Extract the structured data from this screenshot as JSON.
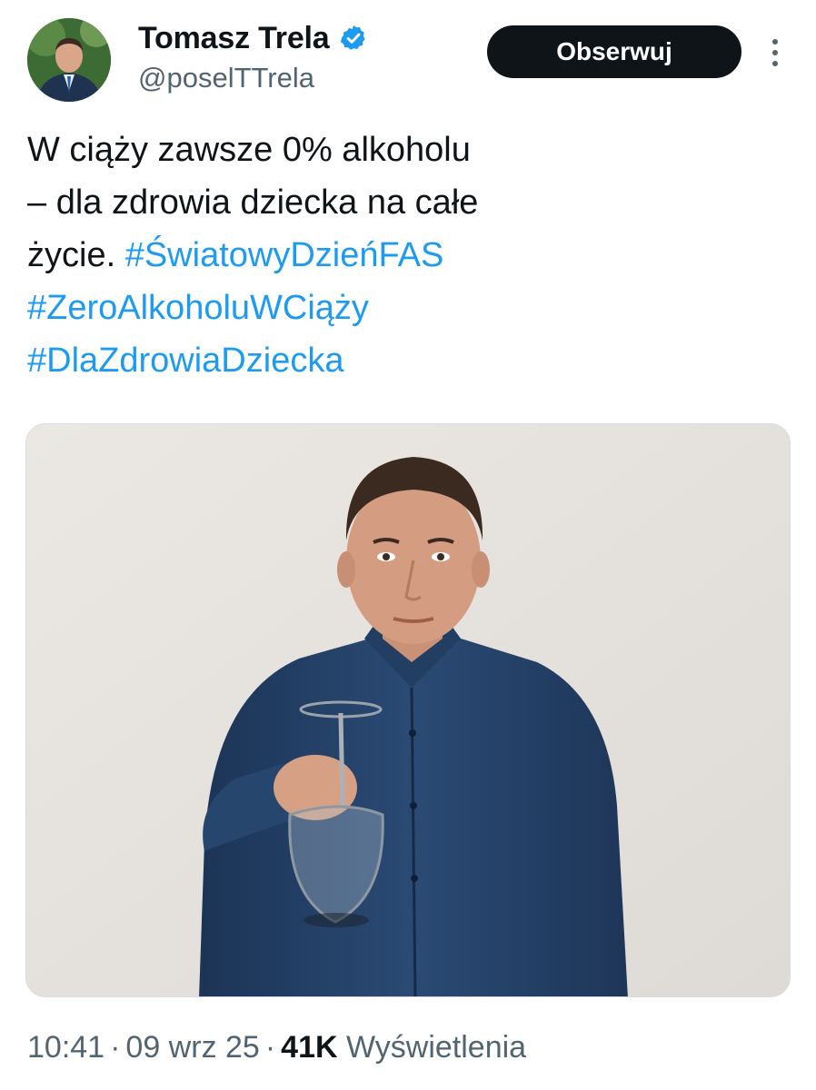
{
  "author": {
    "name": "Tomasz Trela",
    "handle": "@poselTTrela",
    "verified": true,
    "verified_color": "#1d9bf0"
  },
  "follow_button": {
    "label": "Obserwuj"
  },
  "more_menu": {
    "icon": "more-vertical-icon"
  },
  "tweet": {
    "text_line_1": "W ciąży zawsze 0% alkoholu",
    "text_line_2": "– dla zdrowia dziecka na całe",
    "text_line_3_prefix": "życie.",
    "hashtags": [
      "#ŚwiatowyDzieńFAS",
      "#ZeroAlkoholuWCiąży",
      "#DlaZdrowiaDziecka"
    ],
    "hashtag_color": "#1d9bf0"
  },
  "media": {
    "type": "photo",
    "subject": "man in blue shirt holding upside-down empty wine glass"
  },
  "meta": {
    "time": "10:41",
    "separator": "·",
    "date": "09 wrz 25",
    "views_count": "41K",
    "views_label": "Wyświetlenia"
  }
}
